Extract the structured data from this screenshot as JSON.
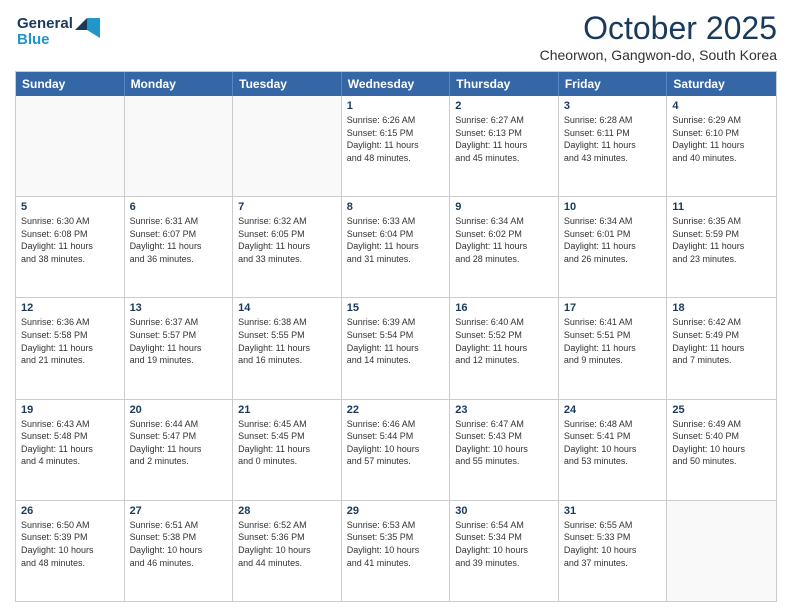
{
  "logo": {
    "line1": "General",
    "line2": "Blue"
  },
  "title": "October 2025",
  "location": "Cheorwon, Gangwon-do, South Korea",
  "header_days": [
    "Sunday",
    "Monday",
    "Tuesday",
    "Wednesday",
    "Thursday",
    "Friday",
    "Saturday"
  ],
  "rows": [
    [
      {
        "day": "",
        "text": ""
      },
      {
        "day": "",
        "text": ""
      },
      {
        "day": "",
        "text": ""
      },
      {
        "day": "1",
        "text": "Sunrise: 6:26 AM\nSunset: 6:15 PM\nDaylight: 11 hours\nand 48 minutes."
      },
      {
        "day": "2",
        "text": "Sunrise: 6:27 AM\nSunset: 6:13 PM\nDaylight: 11 hours\nand 45 minutes."
      },
      {
        "day": "3",
        "text": "Sunrise: 6:28 AM\nSunset: 6:11 PM\nDaylight: 11 hours\nand 43 minutes."
      },
      {
        "day": "4",
        "text": "Sunrise: 6:29 AM\nSunset: 6:10 PM\nDaylight: 11 hours\nand 40 minutes."
      }
    ],
    [
      {
        "day": "5",
        "text": "Sunrise: 6:30 AM\nSunset: 6:08 PM\nDaylight: 11 hours\nand 38 minutes."
      },
      {
        "day": "6",
        "text": "Sunrise: 6:31 AM\nSunset: 6:07 PM\nDaylight: 11 hours\nand 36 minutes."
      },
      {
        "day": "7",
        "text": "Sunrise: 6:32 AM\nSunset: 6:05 PM\nDaylight: 11 hours\nand 33 minutes."
      },
      {
        "day": "8",
        "text": "Sunrise: 6:33 AM\nSunset: 6:04 PM\nDaylight: 11 hours\nand 31 minutes."
      },
      {
        "day": "9",
        "text": "Sunrise: 6:34 AM\nSunset: 6:02 PM\nDaylight: 11 hours\nand 28 minutes."
      },
      {
        "day": "10",
        "text": "Sunrise: 6:34 AM\nSunset: 6:01 PM\nDaylight: 11 hours\nand 26 minutes."
      },
      {
        "day": "11",
        "text": "Sunrise: 6:35 AM\nSunset: 5:59 PM\nDaylight: 11 hours\nand 23 minutes."
      }
    ],
    [
      {
        "day": "12",
        "text": "Sunrise: 6:36 AM\nSunset: 5:58 PM\nDaylight: 11 hours\nand 21 minutes."
      },
      {
        "day": "13",
        "text": "Sunrise: 6:37 AM\nSunset: 5:57 PM\nDaylight: 11 hours\nand 19 minutes."
      },
      {
        "day": "14",
        "text": "Sunrise: 6:38 AM\nSunset: 5:55 PM\nDaylight: 11 hours\nand 16 minutes."
      },
      {
        "day": "15",
        "text": "Sunrise: 6:39 AM\nSunset: 5:54 PM\nDaylight: 11 hours\nand 14 minutes."
      },
      {
        "day": "16",
        "text": "Sunrise: 6:40 AM\nSunset: 5:52 PM\nDaylight: 11 hours\nand 12 minutes."
      },
      {
        "day": "17",
        "text": "Sunrise: 6:41 AM\nSunset: 5:51 PM\nDaylight: 11 hours\nand 9 minutes."
      },
      {
        "day": "18",
        "text": "Sunrise: 6:42 AM\nSunset: 5:49 PM\nDaylight: 11 hours\nand 7 minutes."
      }
    ],
    [
      {
        "day": "19",
        "text": "Sunrise: 6:43 AM\nSunset: 5:48 PM\nDaylight: 11 hours\nand 4 minutes."
      },
      {
        "day": "20",
        "text": "Sunrise: 6:44 AM\nSunset: 5:47 PM\nDaylight: 11 hours\nand 2 minutes."
      },
      {
        "day": "21",
        "text": "Sunrise: 6:45 AM\nSunset: 5:45 PM\nDaylight: 11 hours\nand 0 minutes."
      },
      {
        "day": "22",
        "text": "Sunrise: 6:46 AM\nSunset: 5:44 PM\nDaylight: 10 hours\nand 57 minutes."
      },
      {
        "day": "23",
        "text": "Sunrise: 6:47 AM\nSunset: 5:43 PM\nDaylight: 10 hours\nand 55 minutes."
      },
      {
        "day": "24",
        "text": "Sunrise: 6:48 AM\nSunset: 5:41 PM\nDaylight: 10 hours\nand 53 minutes."
      },
      {
        "day": "25",
        "text": "Sunrise: 6:49 AM\nSunset: 5:40 PM\nDaylight: 10 hours\nand 50 minutes."
      }
    ],
    [
      {
        "day": "26",
        "text": "Sunrise: 6:50 AM\nSunset: 5:39 PM\nDaylight: 10 hours\nand 48 minutes."
      },
      {
        "day": "27",
        "text": "Sunrise: 6:51 AM\nSunset: 5:38 PM\nDaylight: 10 hours\nand 46 minutes."
      },
      {
        "day": "28",
        "text": "Sunrise: 6:52 AM\nSunset: 5:36 PM\nDaylight: 10 hours\nand 44 minutes."
      },
      {
        "day": "29",
        "text": "Sunrise: 6:53 AM\nSunset: 5:35 PM\nDaylight: 10 hours\nand 41 minutes."
      },
      {
        "day": "30",
        "text": "Sunrise: 6:54 AM\nSunset: 5:34 PM\nDaylight: 10 hours\nand 39 minutes."
      },
      {
        "day": "31",
        "text": "Sunrise: 6:55 AM\nSunset: 5:33 PM\nDaylight: 10 hours\nand 37 minutes."
      },
      {
        "day": "",
        "text": ""
      }
    ]
  ]
}
